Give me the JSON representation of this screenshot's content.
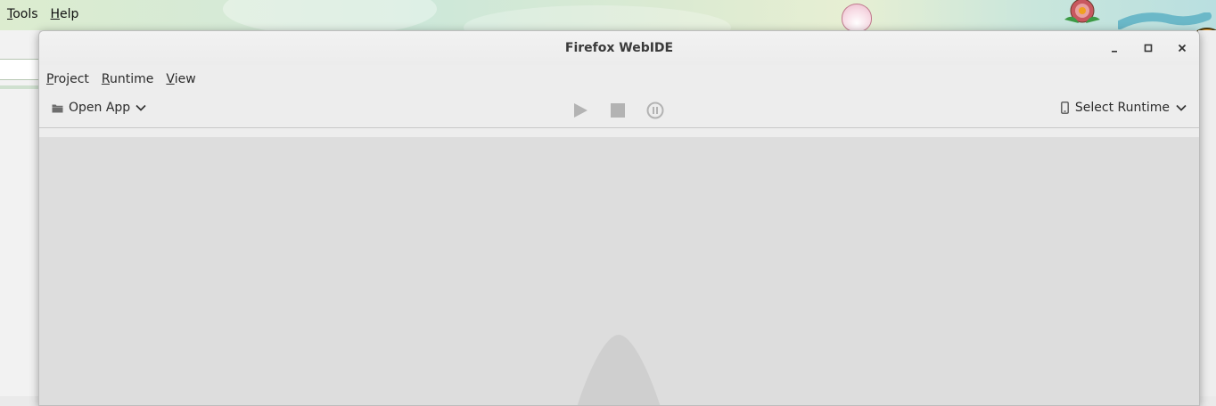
{
  "background_browser": {
    "menus": [
      {
        "label_first": "T",
        "label_rest": "ools"
      },
      {
        "label_first": "H",
        "label_rest": "elp"
      }
    ]
  },
  "window": {
    "title": "Firefox WebIDE",
    "controls": {
      "minimize": "_",
      "maximize": "□",
      "close": "✕"
    },
    "menus": [
      {
        "label_first": "P",
        "label_rest": "roject"
      },
      {
        "label_first": "R",
        "label_rest": "untime"
      },
      {
        "label_first": "V",
        "label_rest": "iew"
      }
    ],
    "toolbar": {
      "open_app_label": "Open App",
      "select_runtime_label": "Select Runtime",
      "play_icon": "play-icon",
      "stop_icon": "stop-icon",
      "pause_icon": "pause-icon"
    }
  },
  "colors": {
    "content_bg": "#dddddd",
    "toolbar_icon": "#b3b3b3",
    "logo": "#cfcfcf"
  }
}
